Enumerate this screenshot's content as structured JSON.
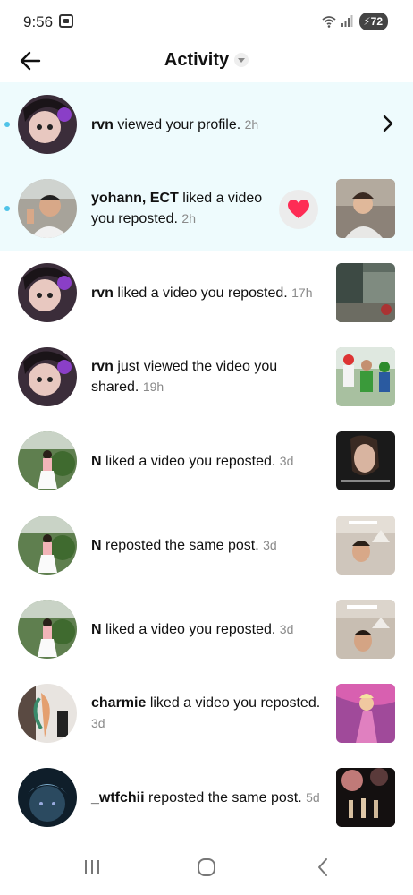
{
  "status_bar": {
    "time": "9:56",
    "battery": "72"
  },
  "header": {
    "title": "Activity"
  },
  "notifications": [
    {
      "user": "rvn",
      "action": " viewed your profile. ",
      "time": "2h",
      "unread": true,
      "trailing": "chevron"
    },
    {
      "user": "yohann, ECT",
      "action": " liked a video you reposted. ",
      "time": "2h",
      "unread": true,
      "trailing": "thumbnail"
    },
    {
      "user": "rvn",
      "action": " liked a video you reposted. ",
      "time": "17h",
      "unread": false,
      "trailing": "thumbnail"
    },
    {
      "user": "rvn",
      "action": " just viewed the video you shared. ",
      "time": "19h",
      "unread": false,
      "trailing": "thumbnail"
    },
    {
      "user": "N",
      "action": " liked a video you reposted. ",
      "time": "3d",
      "unread": false,
      "trailing": "thumbnail"
    },
    {
      "user": "N",
      "action": " reposted the same post. ",
      "time": "3d",
      "unread": false,
      "trailing": "thumbnail"
    },
    {
      "user": "N",
      "action": " liked a video you reposted. ",
      "time": "3d",
      "unread": false,
      "trailing": "thumbnail"
    },
    {
      "user": "charmie",
      "action": " liked a video you reposted. ",
      "time": "3d",
      "unread": false,
      "trailing": "thumbnail"
    },
    {
      "user": "_wtfchii",
      "action": " reposted the same post. ",
      "time": "5d",
      "unread": false,
      "trailing": "thumbnail"
    }
  ],
  "icons": {
    "back": "arrow-left-icon",
    "dropdown": "caret-down-icon",
    "chevron": "chevron-right-icon",
    "heart": "heart-icon",
    "nav_recents": "recents-icon",
    "nav_home": "home-icon",
    "nav_back": "back-icon"
  },
  "colors": {
    "unread_bg": "#eefbfd",
    "unread_dot": "#4fc3e8",
    "heart": "#fe2c55",
    "time_text": "#8a8a8a"
  }
}
